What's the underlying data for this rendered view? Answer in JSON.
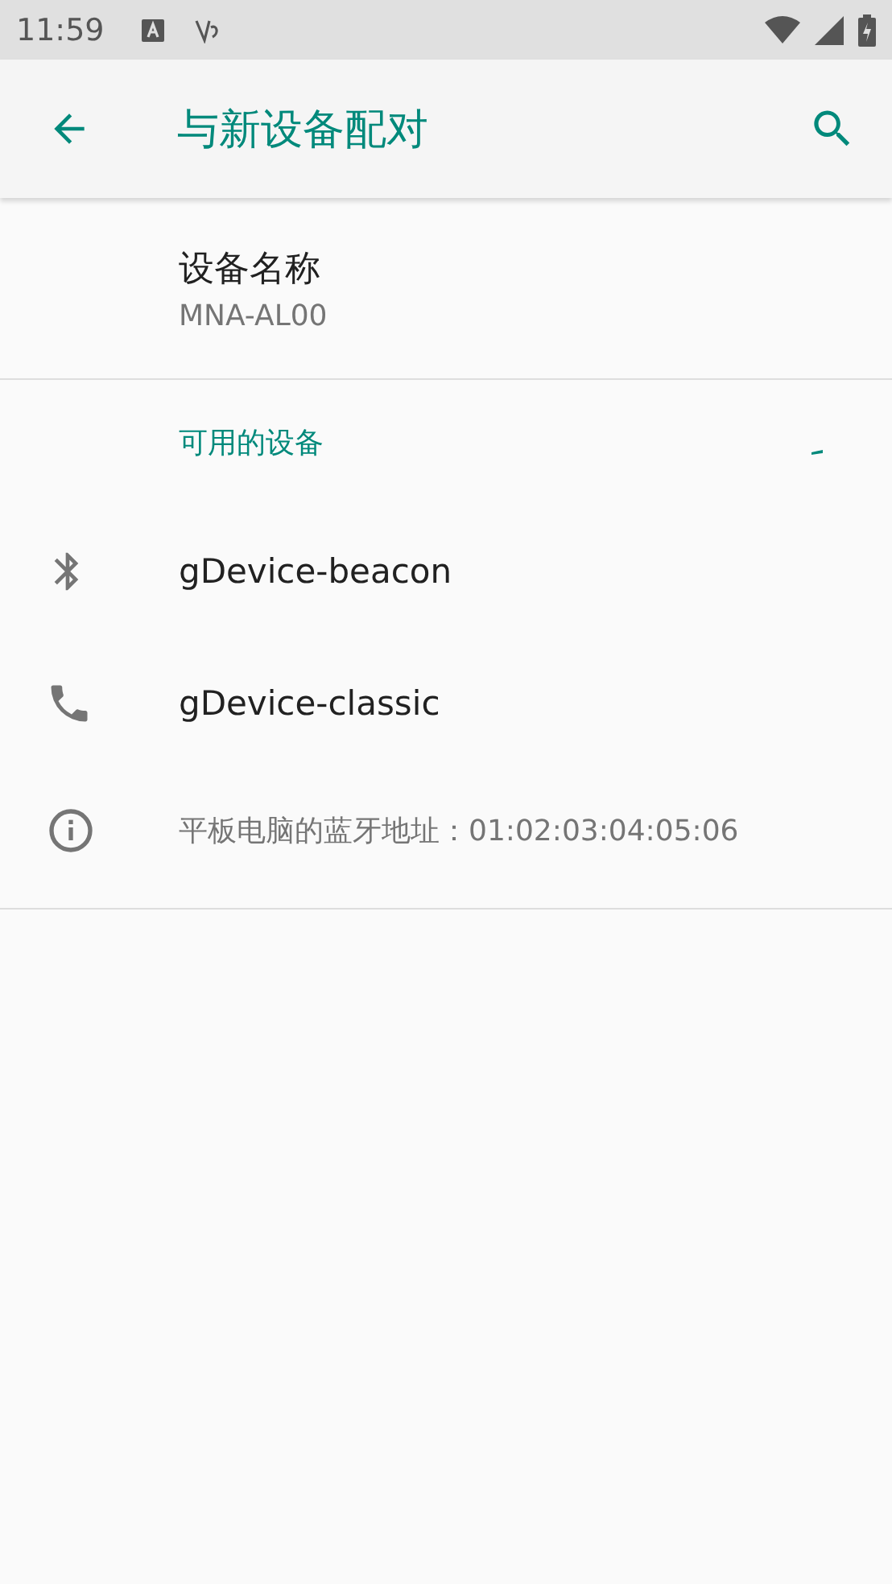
{
  "status_bar": {
    "time": "11:59"
  },
  "app_bar": {
    "title": "与新设备配对"
  },
  "device_name": {
    "title": "设备名称",
    "value": "MNA-AL00"
  },
  "available": {
    "header": "可用的设备",
    "scanning": true,
    "devices": [
      {
        "kind": "bluetooth",
        "name": "gDevice-beacon"
      },
      {
        "kind": "phone",
        "name": "gDevice-classic"
      }
    ]
  },
  "address": {
    "text": "平板电脑的蓝牙地址：01:02:03:04:05:06"
  }
}
